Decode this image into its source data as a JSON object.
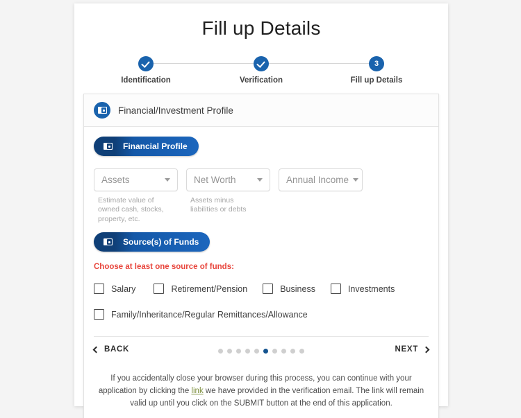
{
  "page": {
    "title": "Fill up Details",
    "background_color": "#f4f4f4",
    "accent_color": "#1a63ad",
    "error_color": "#e8453c"
  },
  "stepper": {
    "steps": [
      {
        "label": "Identification",
        "state": "complete",
        "marker": "check-icon"
      },
      {
        "label": "Verification",
        "state": "complete",
        "marker": "check-icon"
      },
      {
        "label": "Fill up Details",
        "state": "current",
        "marker": "3"
      }
    ]
  },
  "panel": {
    "header": {
      "icon": "wallet-icon",
      "title": "Financial/Investment Profile"
    },
    "financial_profile": {
      "badge_label": "Financial Profile",
      "badge_icon": "wallet-icon",
      "fields": [
        {
          "name": "assets",
          "value": "Assets",
          "placeholder": "Assets",
          "help": "Estimate value of owned cash, stocks, property, etc."
        },
        {
          "name": "net-worth",
          "value": "Net Worth",
          "placeholder": "Net Worth",
          "help": "Assets minus liabilities or debts"
        },
        {
          "name": "annual-income",
          "value": "Annual Income",
          "placeholder": "Annual Income",
          "help": ""
        }
      ]
    },
    "sources_of_funds": {
      "badge_label": "Source(s) of Funds",
      "badge_icon": "wallet-icon",
      "error_message": "Choose at least one source of funds:",
      "options_row_1": [
        {
          "label": "Salary",
          "checked": false
        },
        {
          "label": "Retirement/Pension",
          "checked": false
        },
        {
          "label": "Business",
          "checked": false
        },
        {
          "label": "Investments",
          "checked": false
        }
      ],
      "options_row_2": [
        {
          "label": "Family/Inheritance/Regular Remittances/Allowance",
          "checked": false
        }
      ]
    },
    "navigation": {
      "back_label": "BACK",
      "next_label": "NEXT",
      "back_icon": "chevron-left-icon",
      "next_icon": "chevron-right-icon",
      "dots_total": 10,
      "dots_active_index": 6
    }
  },
  "disclaimer": {
    "part1": "If you accidentally close your browser during this process, you can continue with your application by clicking the ",
    "link_text": "link",
    "part2": " we have provided in the verification email. The link will remain valid up until you click on the SUBMIT button at the end of this application."
  }
}
